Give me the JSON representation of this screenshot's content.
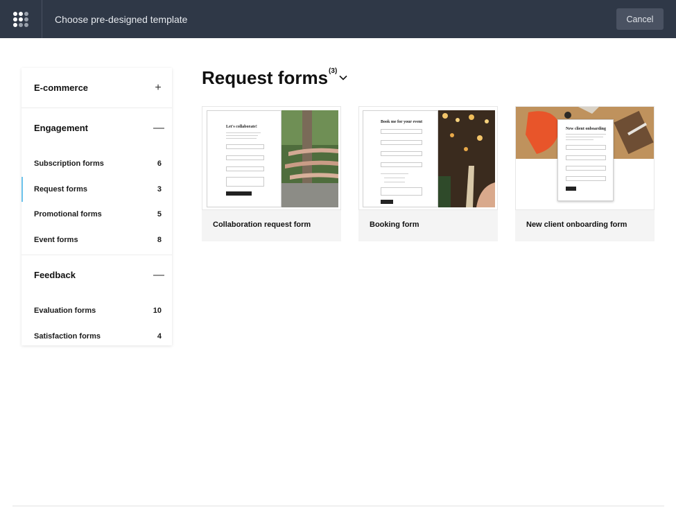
{
  "header": {
    "title": "Choose pre-designed template",
    "cancel_label": "Cancel"
  },
  "sidebar": {
    "sections": [
      {
        "title": "E-commerce",
        "toggle": "+",
        "expanded": false,
        "items": []
      },
      {
        "title": "Engagement",
        "toggle": "—",
        "expanded": true,
        "items": [
          {
            "label": "Subscription forms",
            "count": "6"
          },
          {
            "label": "Request forms",
            "count": "3",
            "active": true
          },
          {
            "label": "Promotional forms",
            "count": "5"
          },
          {
            "label": "Event forms",
            "count": "8"
          }
        ]
      },
      {
        "title": "Feedback",
        "toggle": "—",
        "expanded": true,
        "items": [
          {
            "label": "Evaluation forms",
            "count": "10"
          },
          {
            "label": "Satisfaction forms",
            "count": "4"
          }
        ]
      }
    ]
  },
  "main": {
    "heading": "Request forms",
    "heading_count": "(3)",
    "templates": [
      {
        "name": "Collaboration request form",
        "preview_title": "Let's collaborate!",
        "preview_bg": "#4f6d3d"
      },
      {
        "name": "Booking form",
        "preview_title": "Book me for your event",
        "preview_bg": "#3a2b1e"
      },
      {
        "name": "New client onboarding form",
        "preview_title": "New client onboarding",
        "preview_bg": "#b98a54"
      }
    ]
  },
  "colors": {
    "header_bg": "#2f3847",
    "active_indicator": "#6cc3ec",
    "card_bg": "#f4f4f4"
  }
}
